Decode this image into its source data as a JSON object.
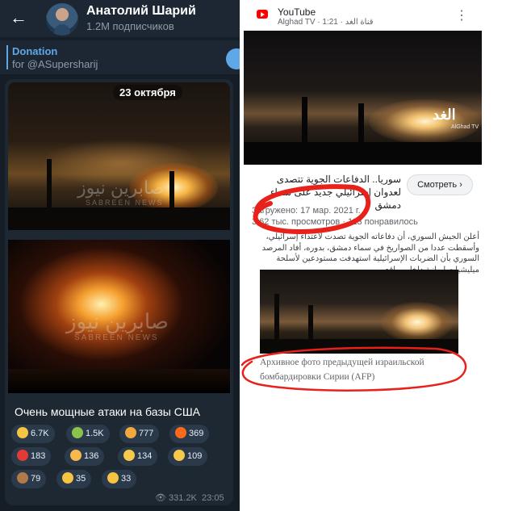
{
  "telegram": {
    "channel_name": "Анатолий Шарий",
    "subscribers": "1.2M подписчиков",
    "pinned_title": "Donation",
    "pinned_text": "for @ASupersharij",
    "post": {
      "date_badge": "23 октября",
      "watermark_latin": "SABREEN NEWS",
      "watermark_arabic": "صابرين نيوز",
      "caption": "Очень мощные атаки на базы США",
      "reactions": [
        {
          "emoji": "thumbs-up",
          "count": "6.7K",
          "color": "#f5c542"
        },
        {
          "emoji": "champagne",
          "count": "1.5K",
          "color": "#8bc34a"
        },
        {
          "emoji": "exploding-head",
          "count": "777",
          "color": "#f2a93b"
        },
        {
          "emoji": "fire",
          "count": "369",
          "color": "#ff6a1a"
        },
        {
          "emoji": "heart",
          "count": "183",
          "color": "#e53935"
        },
        {
          "emoji": "party-popper",
          "count": "136",
          "color": "#f8b84e"
        },
        {
          "emoji": "screaming-face",
          "count": "134",
          "color": "#f6c94a"
        },
        {
          "emoji": "crying-face",
          "count": "109",
          "color": "#f6c94a"
        },
        {
          "emoji": "see-no-evil-monkey",
          "count": "79",
          "color": "#b07a4a"
        },
        {
          "emoji": "clapping-hands",
          "count": "35",
          "color": "#f5c542"
        },
        {
          "emoji": "folded-hands",
          "count": "33",
          "color": "#f5c542"
        }
      ],
      "views": "331.2K",
      "time": "23:05"
    }
  },
  "youtube": {
    "app_name": "YouTube",
    "source_line": "Alghad TV · 1:21 · قناة الغد",
    "channel_brand": "الغد",
    "channel_brand_sub": "AlGhad TV",
    "video_title": "سوريا.. الدفاعات الجوية تتصدى لعدوان إسرائيلي جديد على سماء دمشق",
    "watch_label": "Смотреть",
    "uploaded": "Загружено: 17 мар. 2021 г.",
    "stats": "3,62 тыс. просмотров · 113 понравилось",
    "description": "أعلن الجيش السوري، أن دفاعاته الجوية تصدت لاعتداء إسرائيلي، وأسقطت عددا من الصواريخ في سماء دمشق، بدوره، أفاد المرصد السوري بأن الضربات الإسرائيلية استهدفت مستودعين لأسلحة ميليشيات إيرانية داخل مواقع ..."
  },
  "article": {
    "caption_line1": "Архивное фото предыдущей израильской",
    "caption_line2": "бомбардировки Сирии (AFP)"
  },
  "annotation_color": "#e8211b"
}
